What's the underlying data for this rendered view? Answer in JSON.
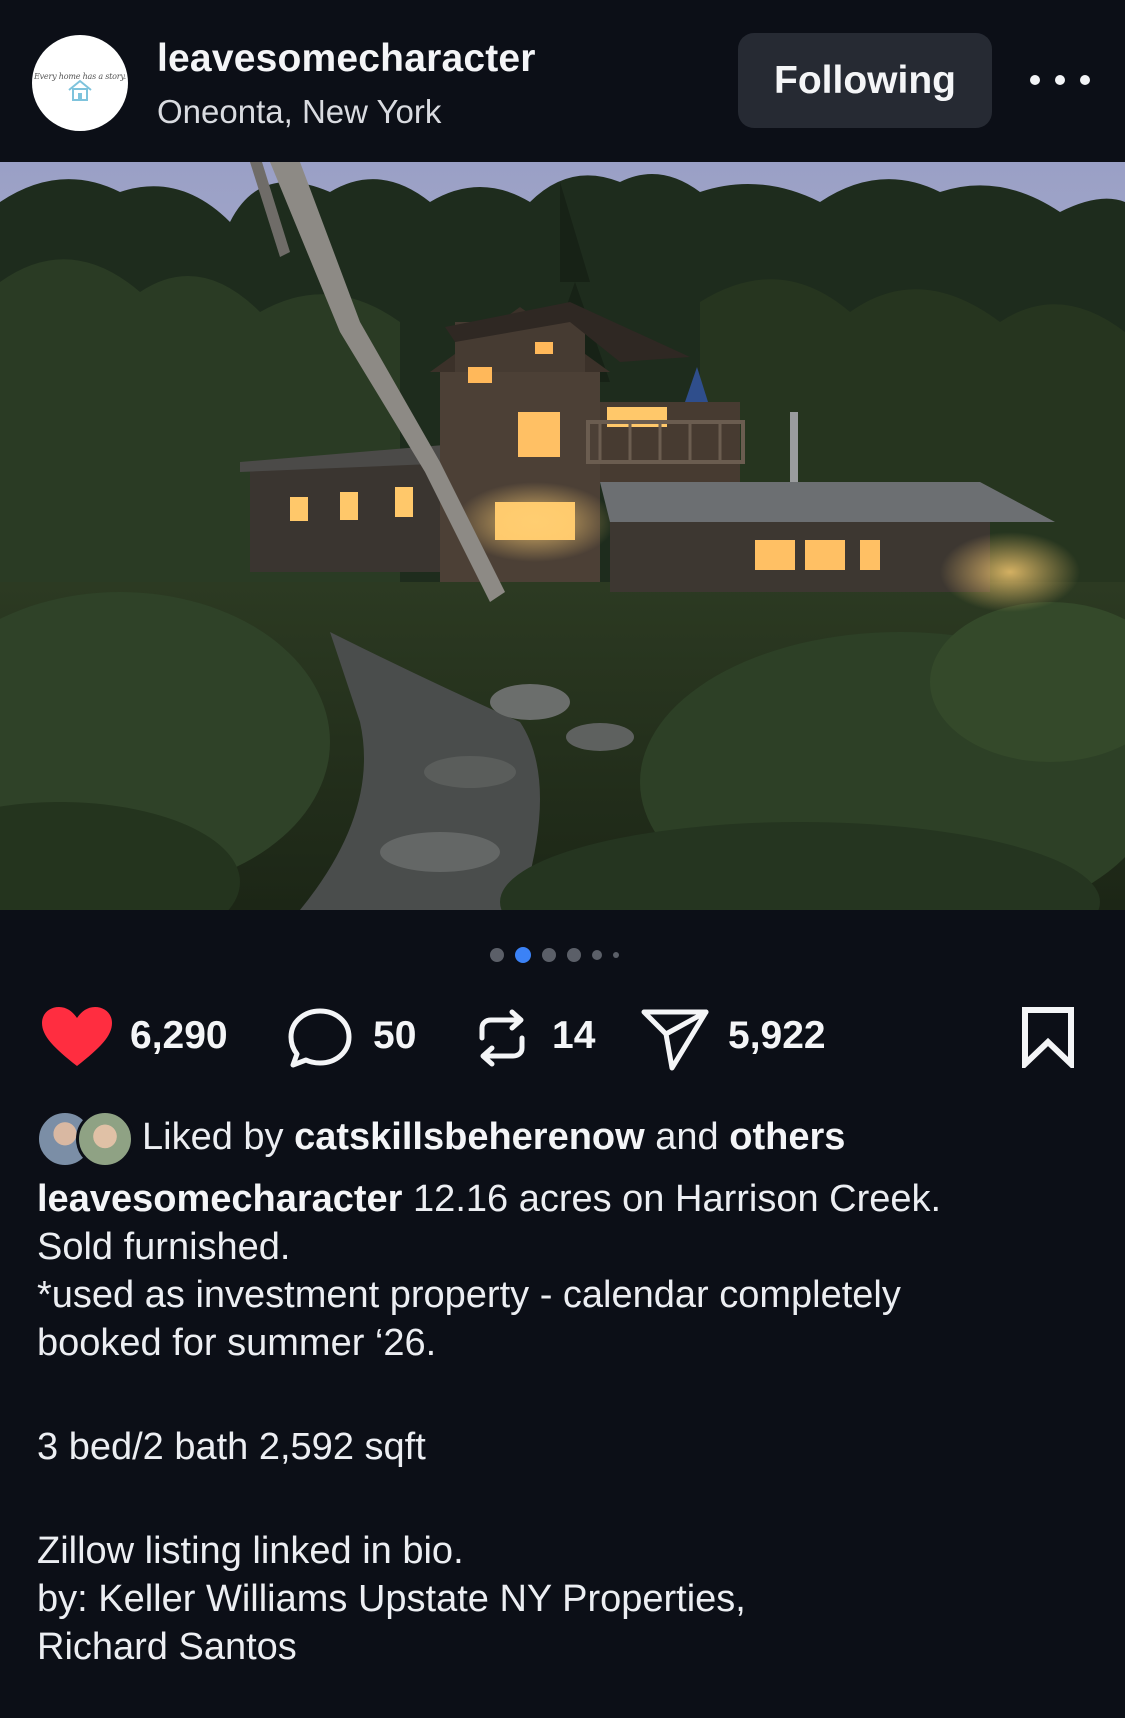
{
  "header": {
    "username": "leavesomecharacter",
    "location": "Oneonta, New York",
    "avatar_tagline": "Every home has a story.",
    "follow_label": "Following",
    "more_icon": "more-horizontal-icon"
  },
  "carousel": {
    "count": 6,
    "active_index": 1
  },
  "actions": {
    "likes": "6,290",
    "comments": "50",
    "reposts": "14",
    "shares": "5,922",
    "like_color": "#ff2d40"
  },
  "liked_by": {
    "prefix": "Liked by",
    "user": "catskillsbeherenow",
    "joiner": "and",
    "others": "others"
  },
  "caption": {
    "author": "leavesomecharacter",
    "line1": "12.16 acres on Harrison Creek.",
    "line2": "Sold furnished.",
    "line3": "*used as investment property - calendar completely",
    "line4": "booked for summer ‘26.",
    "line5": "3 bed/2 bath 2,592 sqft",
    "line6": "Zillow listing linked in bio.",
    "line7": "by: Keller Williams Upstate NY Properties,",
    "line8": "Richard Santos"
  },
  "colors": {
    "background": "#0c0f17",
    "button": "#262a33",
    "active_dot": "#3b82f6"
  }
}
